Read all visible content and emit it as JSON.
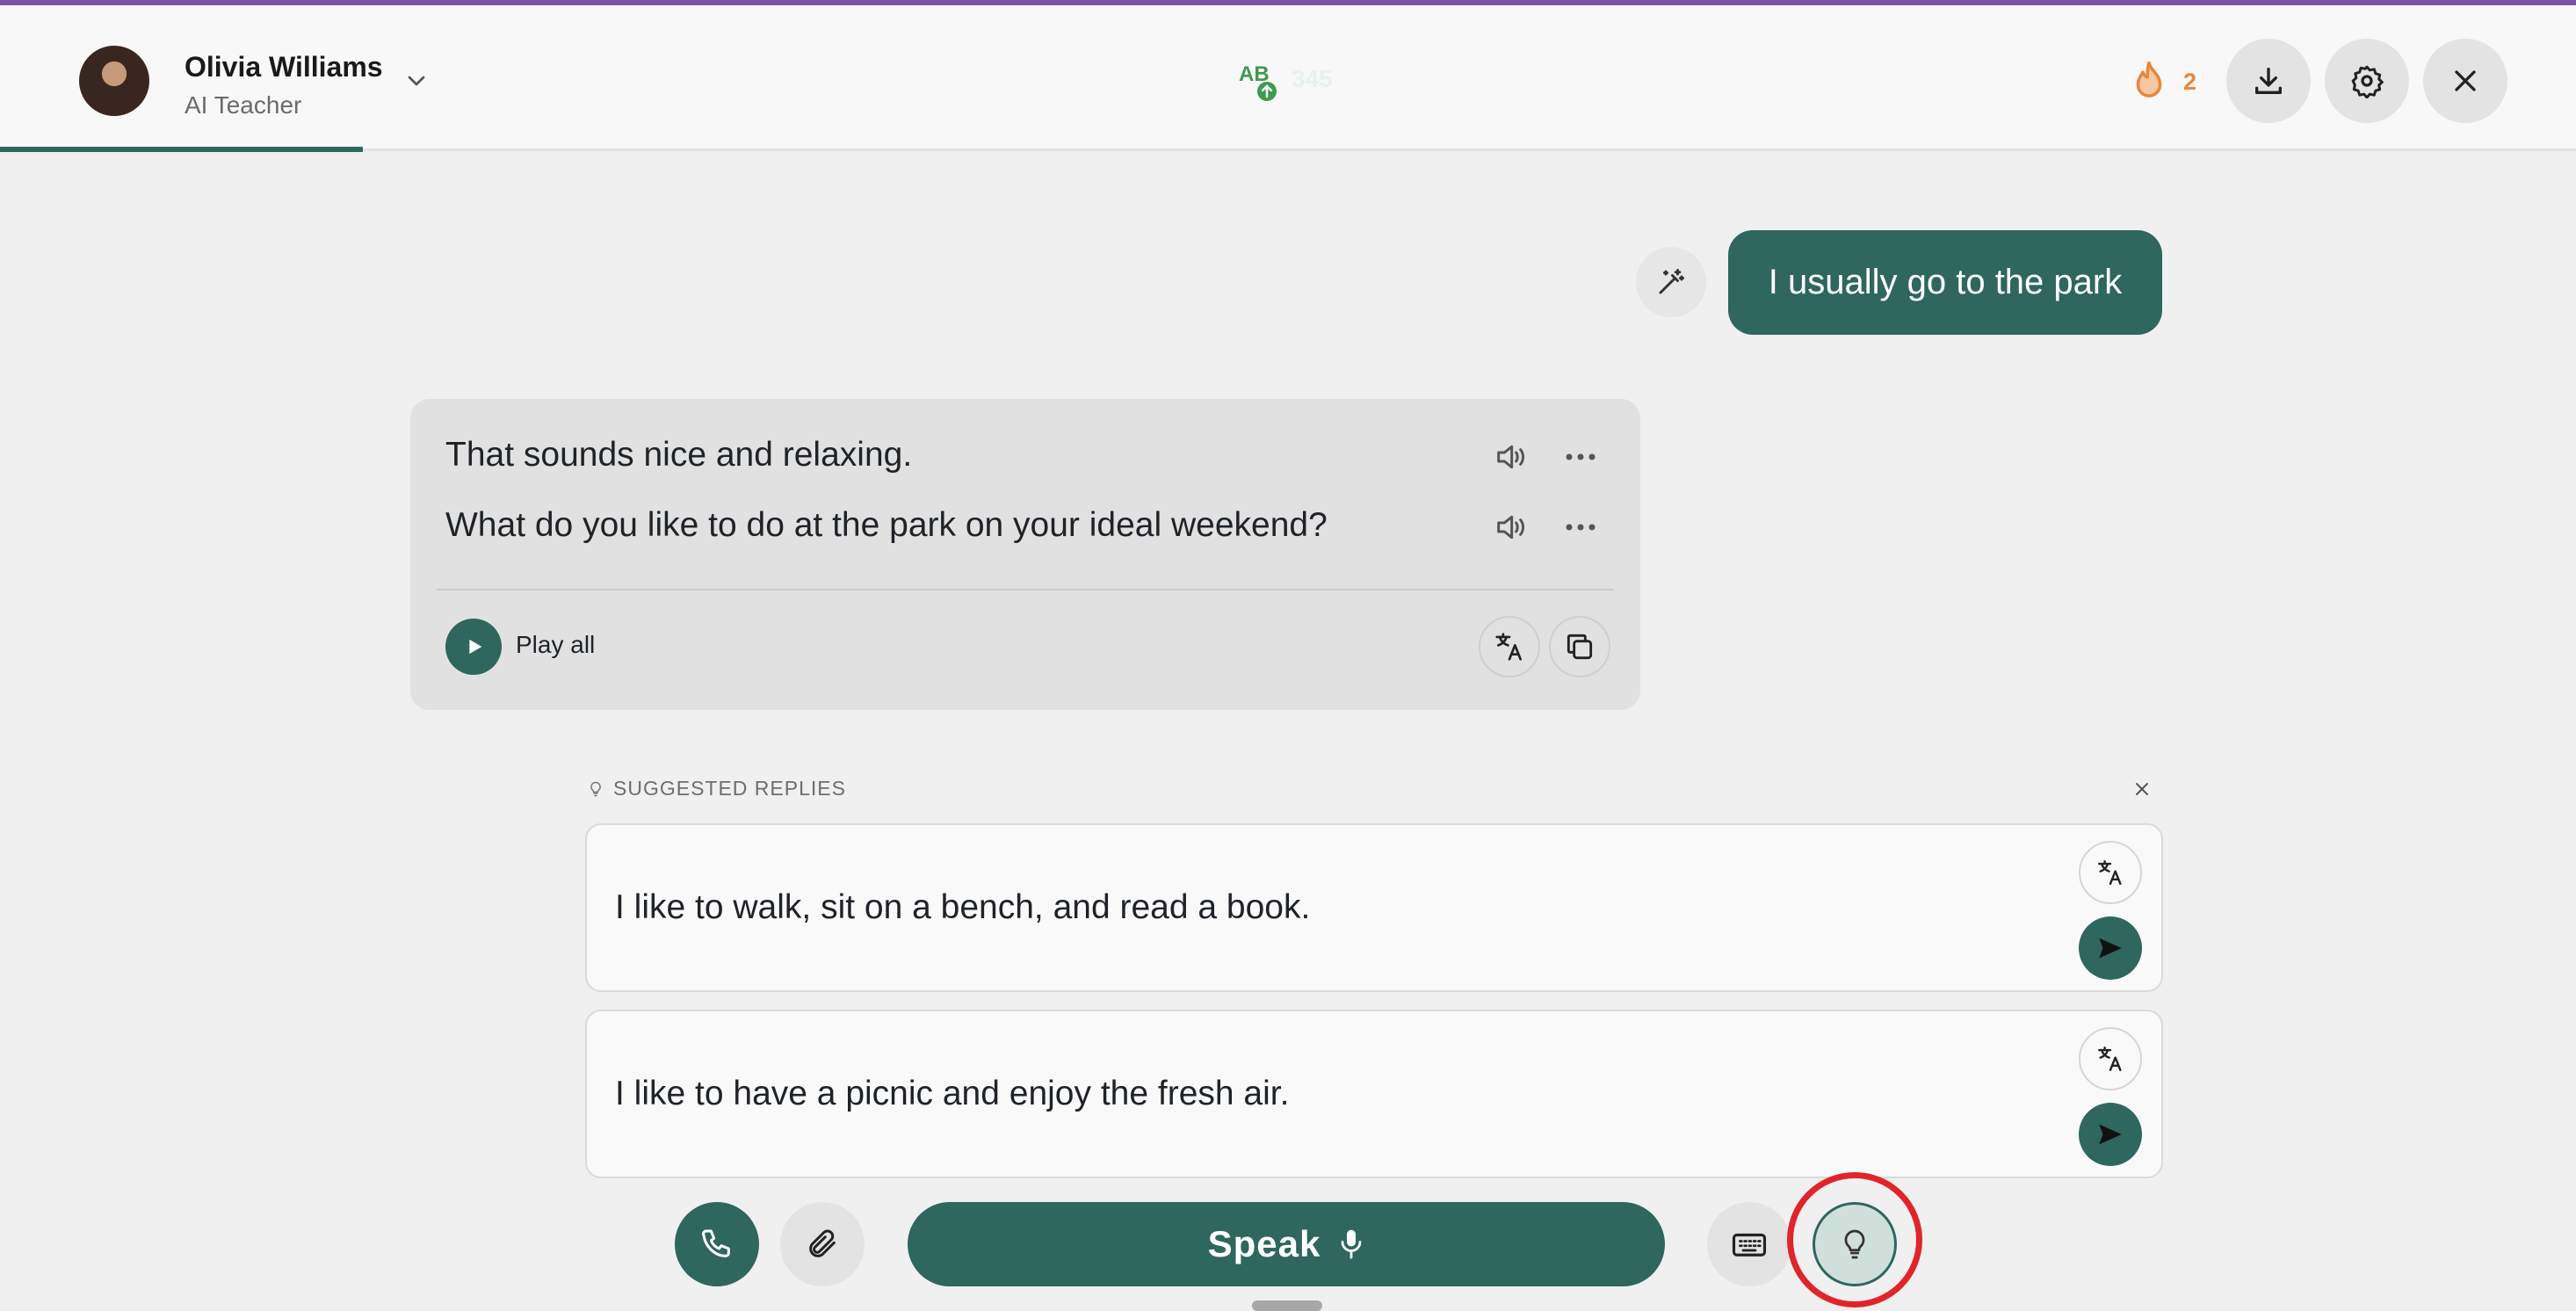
{
  "header": {
    "teacher_name": "Olivia Williams",
    "teacher_role": "AI Teacher",
    "level_badge_text": "AB",
    "level_number": "345",
    "streak_count": "2",
    "icons": [
      "download-icon",
      "gear-icon",
      "close-icon",
      "flame-icon",
      "chevron-down-icon"
    ]
  },
  "conversation": {
    "user_message": "I usually go to the park",
    "ai_lines": [
      "That sounds nice and relaxing.",
      "What do you like to do at the park on your ideal weekend?"
    ],
    "play_all_label": "Play all"
  },
  "suggestions": {
    "heading": "SUGGESTED REPLIES",
    "items": [
      "I like to walk, sit on a bench, and read a book.",
      "I like to have a picnic and enjoy the fresh air."
    ]
  },
  "bottom_bar": {
    "speak_label": "Speak"
  },
  "colors": {
    "accent": "#2f665e",
    "top_line": "#7a52a8",
    "streak": "#e8873a",
    "highlight": "#e0242a"
  }
}
